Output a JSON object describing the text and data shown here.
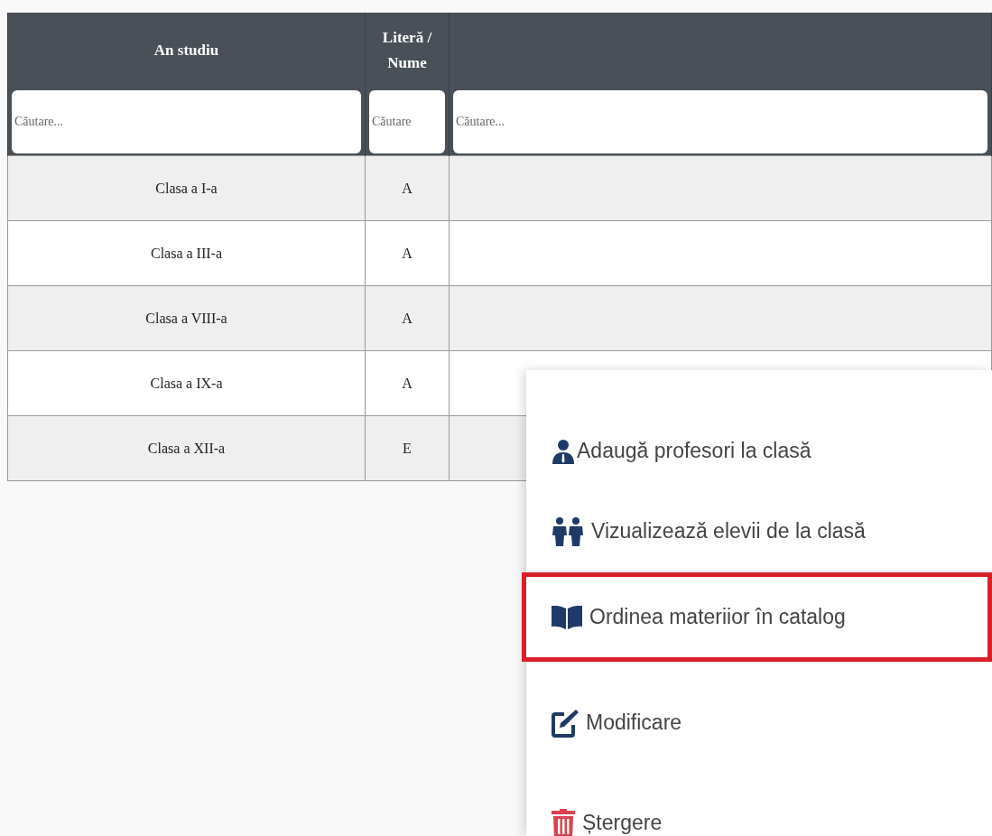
{
  "table": {
    "columns": [
      "An studiu",
      "Literă / Nume",
      ""
    ],
    "filters": [
      {
        "placeholder": "Căutare..."
      },
      {
        "placeholder": "Căutare"
      },
      {
        "placeholder": "Căutare..."
      }
    ],
    "rows": [
      {
        "cells": [
          "Clasa a I-a",
          "A"
        ]
      },
      {
        "cells": [
          "Clasa a III-a",
          "A"
        ]
      },
      {
        "cells": [
          "Clasa a VIII-a",
          "A"
        ]
      },
      {
        "cells": [
          "Clasa a IX-a",
          "A"
        ]
      },
      {
        "cells": [
          "Clasa a XII-a",
          "E"
        ]
      }
    ]
  },
  "context_menu": {
    "items": [
      {
        "kind": "teacher",
        "label": "Adaugă profesori la clasă",
        "highlighted": false
      },
      {
        "kind": "students",
        "label": "Vizualizează elevii de la clasă",
        "highlighted": false
      },
      {
        "kind": "book",
        "label": "Ordinea materiior în catalog",
        "highlighted": true
      },
      {
        "kind": "edit",
        "label": "Modificare",
        "highlighted": false
      },
      {
        "kind": "delete",
        "label": "Ștergere",
        "highlighted": false
      }
    ]
  }
}
